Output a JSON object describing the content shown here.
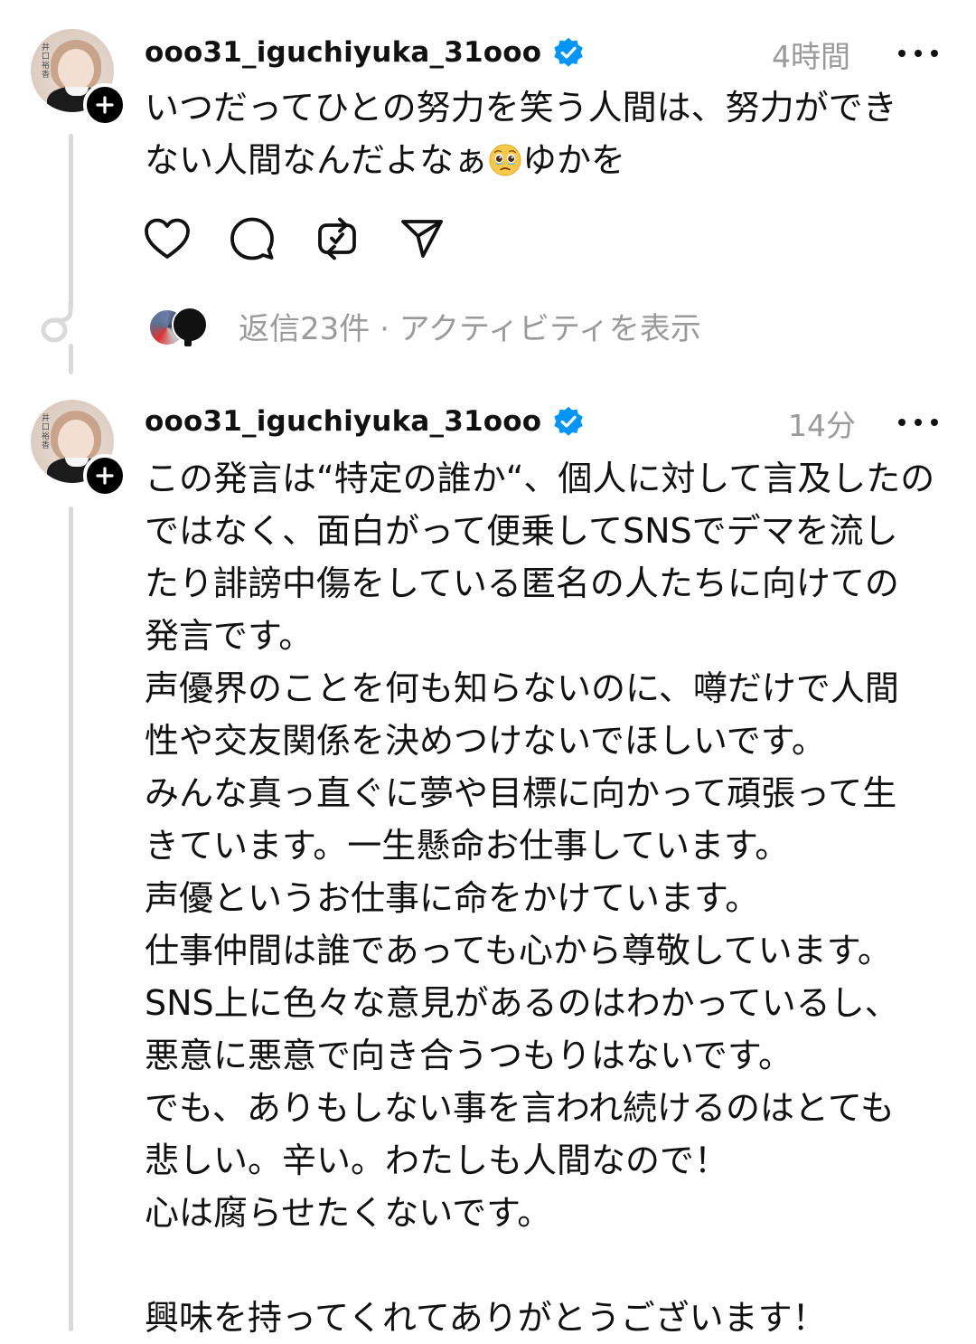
{
  "post1": {
    "username": "ooo31_iguchiyuka_31ooo",
    "time": "4時間",
    "text_before_emoji": "いつだってひとの努力を笑う人間は、努力ができ\nない人間なんだよなぁ",
    "emoji_icon": "crying-face-emoji-icon",
    "text_after_emoji": "ゆかを",
    "replies_text": "返信23件 · アクティビティを表示"
  },
  "post2": {
    "username": "ooo31_iguchiyuka_31ooo",
    "time": "14分",
    "text": "この発言は“特定の誰か“、個人に対して言及したの\nではなく、面白がって便乗してSNSでデマを流し\nたり誹謗中傷をしている匿名の人たちに向けての\n発言です。\n声優界のことを何も知らないのに、噂だけで人間\n性や交友関係を決めつけないでほしいです。\nみんな真っ直ぐに夢や目標に向かって頑張って生\nきています。一生懸命お仕事しています。\n声優というお仕事に命をかけています。\n仕事仲間は誰であっても心から尊敬しています。\nSNS上に色々な意見があるのはわかっているし、\n悪意に悪意で向き合うつもりはないです。\nでも、ありもしない事を言われ続けるのはとても\n悲しい。辛い。わたしも人間なので！\n心は腐らせたくないです。\n\n興味を持ってくれてありがとうございます！"
  },
  "avatar_sign_text": "井口裕香",
  "colors": {
    "verified_blue": "#0095f6",
    "muted_gray": "#9a9a9a",
    "thread_line": "#d9d9d9"
  },
  "icons": {
    "like": "heart-icon",
    "reply": "comment-bubble-icon",
    "repost": "repost-arrows-icon",
    "share": "send-paper-plane-icon",
    "more": "more-horizontal-icon",
    "verified": "verified-badge-icon",
    "follow": "plus-icon"
  }
}
